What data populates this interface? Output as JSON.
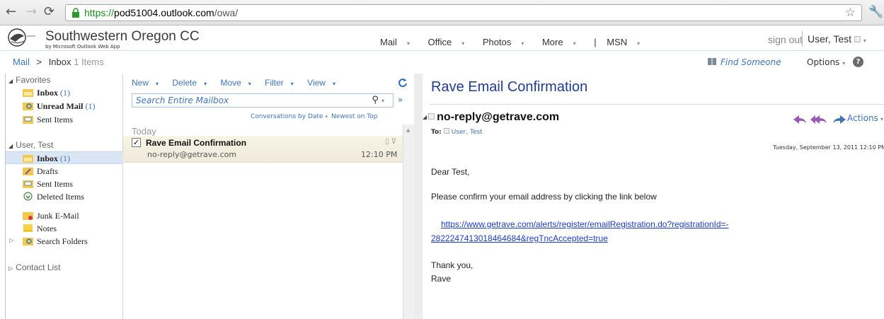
{
  "browser": {
    "url_scheme": "https://",
    "url_domain": "pod51004.outlook.com",
    "url_path": "/owa/"
  },
  "header": {
    "brand": "Southwestern Oregon CC",
    "brand_sub": "by Microsoft Outlook Web App",
    "nav": [
      "Mail",
      "Office",
      "Photos",
      "More",
      "|",
      "MSN"
    ],
    "sign_out": "sign out",
    "user": "User, Test"
  },
  "breadcrumb": {
    "root": "Mail",
    "sep": ">",
    "current": "Inbox",
    "count": "1 Items"
  },
  "topright": {
    "find_someone": "Find Someone",
    "options": "Options"
  },
  "sidebar": {
    "favorites_label": "Favorites",
    "favorites": [
      {
        "label": "Inbox",
        "count": "(1)"
      },
      {
        "label": "Unread Mail",
        "count": "(1)"
      },
      {
        "label": "Sent Items",
        "count": ""
      }
    ],
    "mailbox_label": "User, Test",
    "folders": [
      {
        "label": "Inbox",
        "count": "(1)"
      },
      {
        "label": "Drafts",
        "count": ""
      },
      {
        "label": "Sent Items",
        "count": ""
      },
      {
        "label": "Deleted Items",
        "count": ""
      },
      {
        "label": "Junk E-Mail",
        "count": ""
      },
      {
        "label": "Notes",
        "count": ""
      },
      {
        "label": "Search Folders",
        "count": ""
      }
    ],
    "contact_list": "Contact List"
  },
  "toolbar": {
    "new": "New",
    "delete": "Delete",
    "move": "Move",
    "filter": "Filter",
    "view": "View"
  },
  "search": {
    "placeholder": "Search Entire Mailbox"
  },
  "sort": {
    "by": "Conversations by Date",
    "order": "Newest on Top"
  },
  "list": {
    "group": "Today",
    "messages": [
      {
        "subject": "Rave Email Confirmation",
        "sender": "no-reply@getrave.com",
        "time": "12:10 PM"
      }
    ]
  },
  "reading": {
    "subject": "Rave Email Confirmation",
    "from": "no-reply@getrave.com",
    "to_label": "To:",
    "to": "User, Test",
    "actions": "Actions",
    "date": "Tuesday, September 13, 2011 12:10 PM",
    "greeting": "Dear Test,",
    "line1": "Please confirm your email address by clicking the link below",
    "link_part1": "https://www.getrave.com/alerts/register/emailRegistration.do?registrationId=-",
    "link_part2": "2822247413018464684&regTncAccepted=true",
    "thanks": "Thank you,",
    "signature": "Rave"
  },
  "colors": {
    "link": "#3f74b7",
    "subject": "#1f3c8f",
    "selection": "#dbe6f4",
    "reply_arrows": "#9b59b6",
    "forward_arrow": "#3f74b7"
  }
}
